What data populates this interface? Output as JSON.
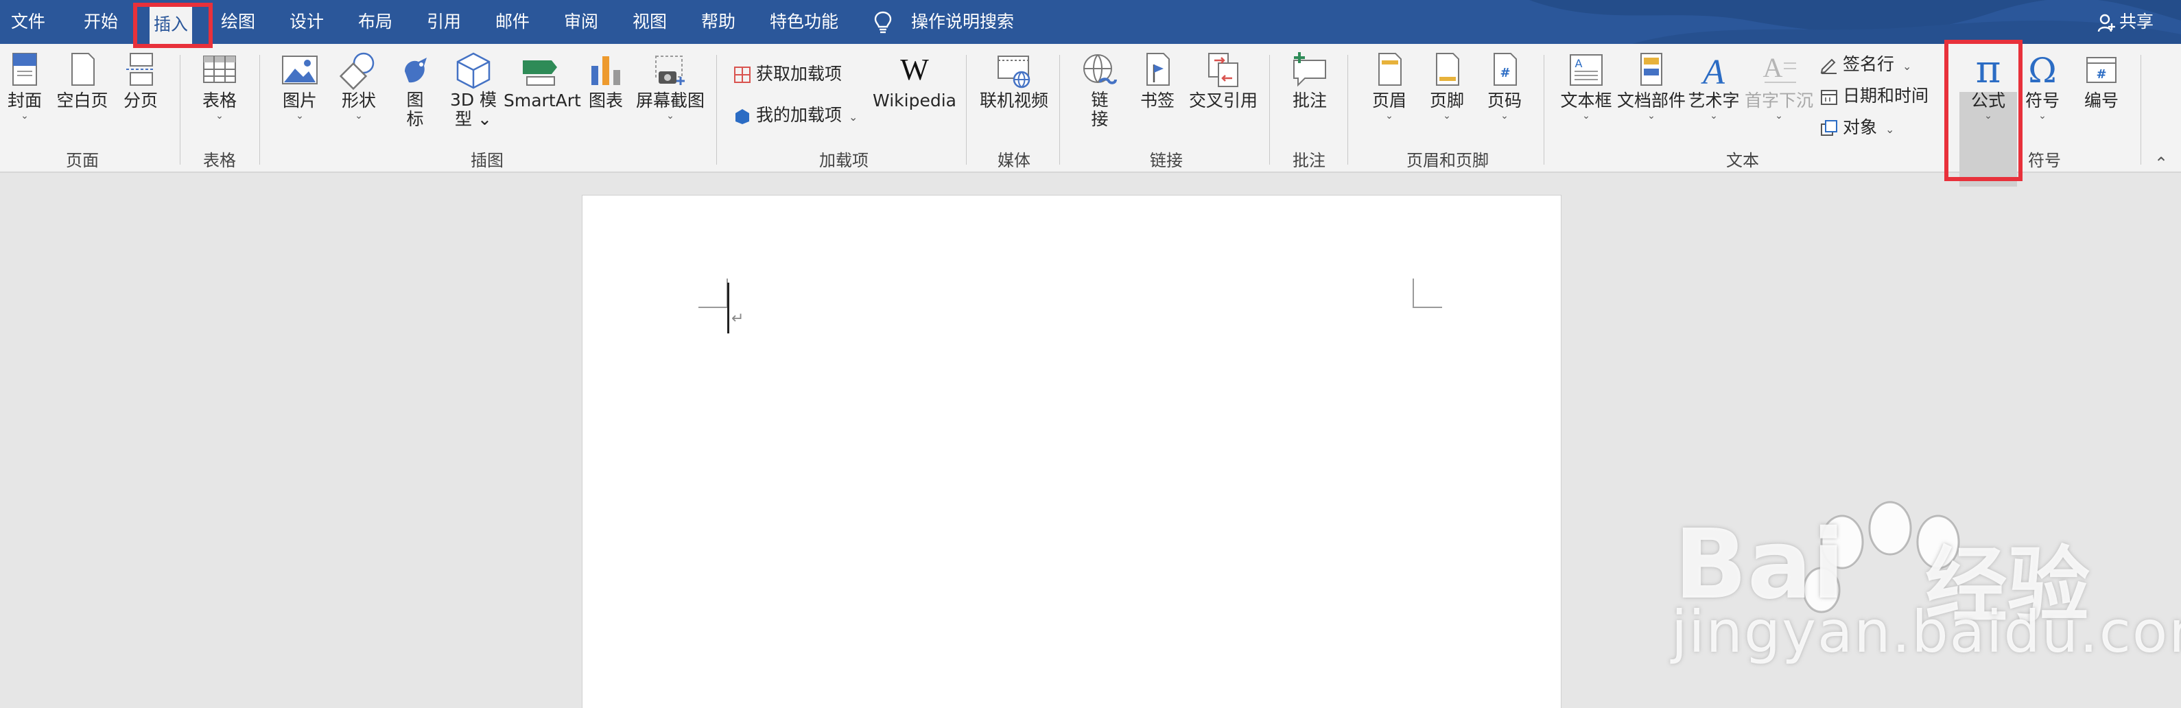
{
  "tabs": [
    "文件",
    "开始",
    "插入",
    "绘图",
    "设计",
    "布局",
    "引用",
    "邮件",
    "审阅",
    "视图",
    "帮助",
    "特色功能"
  ],
  "active_tab": "插入",
  "tell_me": "操作说明搜索",
  "share": "共享",
  "ribbon": {
    "pages": {
      "cover": "封面",
      "blank": "空白页",
      "break": "分页",
      "label": "页面"
    },
    "tables": {
      "table": "表格",
      "label": "表格"
    },
    "illustrations": {
      "pictures": "图片",
      "shapes": "形状",
      "icons": "图\n标",
      "models_3d": "3D 模\n型",
      "smartart": "SmartArt",
      "chart": "图表",
      "screenshot": "屏幕截图",
      "label": "插图"
    },
    "addins": {
      "get": "获取加载项",
      "my": "我的加载项",
      "wikipedia": "Wikipedia",
      "label": "加载项"
    },
    "media": {
      "online_video": "联机视频",
      "label": "媒体"
    },
    "links": {
      "link": "链\n接",
      "bookmark": "书签",
      "cross_ref": "交叉引用",
      "label": "链接"
    },
    "comments": {
      "comment": "批注",
      "label": "批注"
    },
    "header_footer": {
      "header": "页眉",
      "footer": "页脚",
      "page_number": "页码",
      "label": "页眉和页脚"
    },
    "text": {
      "textbox": "文本框",
      "quick_parts": "文档部件",
      "wordart": "艺术字",
      "dropcap": "首字下沉",
      "signature": "签名行",
      "datetime": "日期和时间",
      "object": "对象",
      "label": "文本"
    },
    "symbols": {
      "equation": "公式",
      "symbol": "符号",
      "number": "编号",
      "label": "符号"
    }
  },
  "watermark": {
    "brand": "Bai",
    "brand_cn": "经验",
    "url": "jingyan.baidu.com"
  },
  "colors": {
    "titlebar": "#2b579a",
    "ribbon": "#f3f3f3",
    "highlight": "#e8313b",
    "workspace": "#e6e6e6"
  }
}
